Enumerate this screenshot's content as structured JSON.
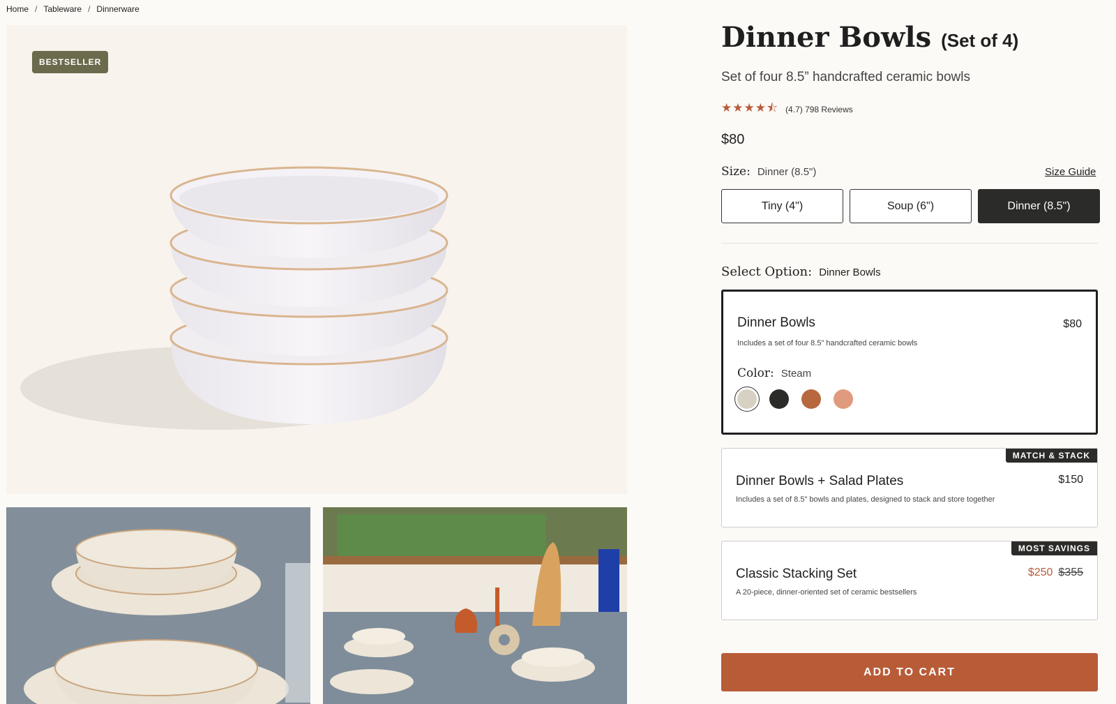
{
  "breadcrumb": {
    "items": [
      "Home",
      "Tableware",
      "Dinnerware"
    ],
    "separator": "/"
  },
  "hero": {
    "badge": "BESTSELLER"
  },
  "product": {
    "title": "Dinner Bowls",
    "title_suffix": "(Set of 4)",
    "subtitle": "Set of four 8.5” handcrafted ceramic bowls",
    "rating_value": 4.5,
    "rating_text": "(4.7) 798 Reviews",
    "price": "$80"
  },
  "size": {
    "label": "Size:",
    "selected": "Dinner (8.5\")",
    "guide_label": "Size Guide",
    "options": [
      "Tiny (4\")",
      "Soup (6\")",
      "Dinner (8.5\")"
    ]
  },
  "select_option": {
    "label": "Select Option:",
    "selected": "Dinner Bowls"
  },
  "options": [
    {
      "name": "Dinner Bowls",
      "price": "$80",
      "desc": "Includes a set of four 8.5\" handcrafted ceramic bowls",
      "color_label": "Color:",
      "color_selected": "Steam",
      "swatches": [
        "#d6d1c2",
        "#2b2b29",
        "#b8683f",
        "#e09a7e"
      ]
    },
    {
      "name": "Dinner Bowls + Salad Plates",
      "price": "$150",
      "desc": "Includes a set of 8.5\" bowls and plates, designed to stack and store together",
      "tag": "MATCH & STACK"
    },
    {
      "name": "Classic Stacking Set",
      "sale_price": "$250",
      "was_price": "$355",
      "desc": "A 20-piece, dinner-oriented set of ceramic bestsellers",
      "tag": "MOST SAVINGS"
    }
  ],
  "cart": {
    "label": "ADD TO CART"
  },
  "colors": {
    "accent": "#b85c38",
    "dark": "#2b2b29",
    "badge": "#6b6a4c",
    "background": "#fcfaf6"
  }
}
